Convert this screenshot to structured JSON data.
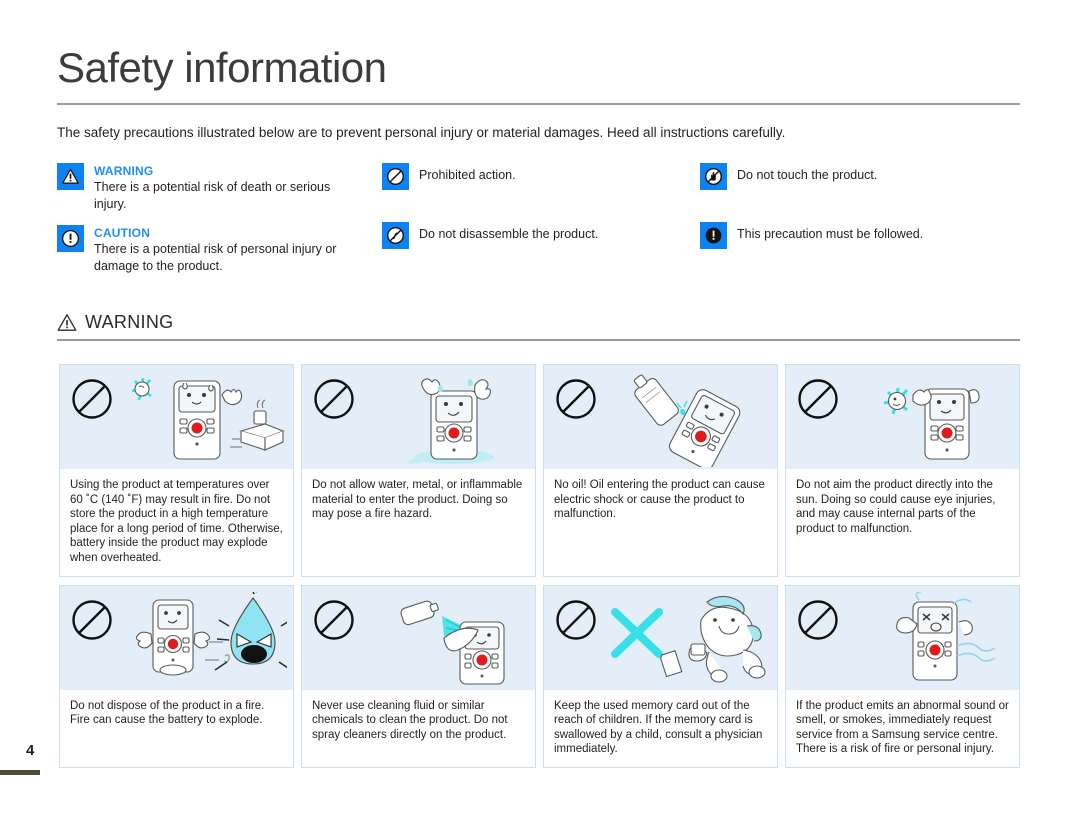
{
  "header": {
    "title": "Safety information",
    "intro": "The safety precautions illustrated below are to prevent personal injury or material damages. Heed all instructions carefully."
  },
  "legend": {
    "column1": [
      {
        "icon": "warning-triangle-icon",
        "heading": "WARNING",
        "description": "There is a potential risk of death or serious injury."
      },
      {
        "icon": "caution-exclamation-icon",
        "heading": "CAUTION",
        "description": "There is a potential risk of personal injury or damage to the product."
      }
    ],
    "column2": [
      {
        "icon": "prohibited-action-icon",
        "description": "Prohibited action."
      },
      {
        "icon": "do-not-disassemble-icon",
        "description": "Do not disassemble the product."
      }
    ],
    "column3": [
      {
        "icon": "do-not-touch-icon",
        "description": "Do not touch the product."
      },
      {
        "icon": "must-be-followed-icon",
        "description": "This precaution must be followed."
      }
    ]
  },
  "section": {
    "icon": "warning-triangle-outline-icon",
    "label": "WARNING"
  },
  "cards": [
    {
      "badge": "prohibited-circle-icon",
      "illustration": "camcorder-overheating-with-sun-and-stove-icon",
      "text": "Using the product at temperatures over 60 ˚C (140 ˚F) may result in fire. Do not store the product in a high temperature place for a long period of time. Otherwise, battery inside the product may explode when overheated."
    },
    {
      "badge": "prohibited-circle-icon",
      "illustration": "camcorder-with-water-and-metal-entering-icon",
      "text": "Do not allow water, metal, or inflammable material to enter the product. Doing so may pose a fire hazard."
    },
    {
      "badge": "prohibited-circle-icon",
      "illustration": "oil-bottle-pouring-on-camcorder-icon",
      "text": "No oil! Oil entering the product can cause electric shock or cause the product to malfunction."
    },
    {
      "badge": "prohibited-circle-icon",
      "illustration": "camcorder-aimed-at-sun-icon",
      "text": "Do not aim the product directly into the sun. Doing so could cause eye injuries, and may cause internal parts of the product to malfunction."
    },
    {
      "badge": "prohibited-circle-icon",
      "illustration": "camcorder-thrown-into-fire-icon",
      "text": "Do not dispose of the product in a fire. Fire can cause the battery to explode."
    },
    {
      "badge": "prohibited-circle-icon",
      "illustration": "spray-cleaner-on-camcorder-icon",
      "text": "Never use cleaning fluid or similar chemicals to clean the product. Do not spray cleaners directly on the product."
    },
    {
      "badge": "prohibited-circle-icon",
      "illustration": "child-swallowing-memory-card-icon",
      "text": "Keep the used memory card out of the reach of children. If the memory card is swallowed by a child, consult a physician immediately."
    },
    {
      "badge": "prohibited-circle-icon",
      "illustration": "camcorder-emitting-smoke-icon",
      "text": "If the product emits an abnormal sound or smell, or smokes, immediately request service from a Samsung service centre. There is a risk of fire or personal injury."
    }
  ],
  "footer": {
    "page_number": "4"
  },
  "colors": {
    "legend_blue": "#0d82f2",
    "heading_blue": "#1f8ff5",
    "card_art_bg": "#e3eef9",
    "card_border": "#cfdff2",
    "footer_bar": "#4f4a32",
    "accent_cyan": "#35e0e8",
    "record_red": "#e01b1b"
  }
}
